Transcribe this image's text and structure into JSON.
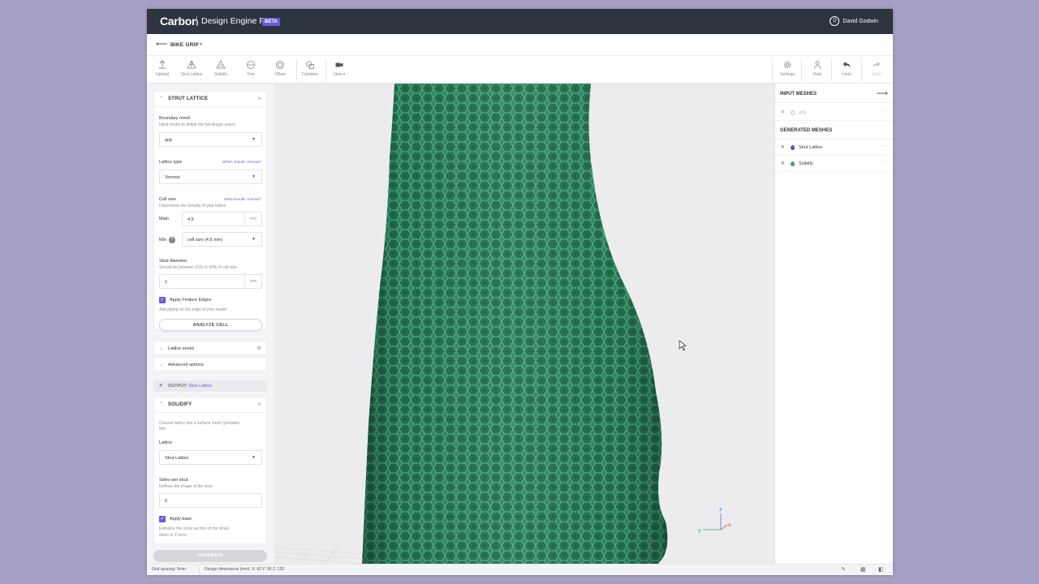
{
  "app": {
    "brand": "Carbon",
    "product": "Design Engine Pro",
    "beta_badge": "BETA",
    "user_initial": "D",
    "user_name": "David Godwin",
    "accent_color": "#6a5bd8"
  },
  "breadcrumb": {
    "back_icon": "arrow-left-icon",
    "project_name": "BIKE GRIP",
    "caret": "▾"
  },
  "toolbar": {
    "left_tools": [
      {
        "label": "Upload",
        "icon": "upload-icon"
      },
      {
        "label": "Strut Lattice",
        "icon": "lattice-icon"
      },
      {
        "label": "Solidify",
        "icon": "solidify-icon"
      },
      {
        "label": "Trim",
        "icon": "trim-icon"
      },
      {
        "label": "Offset",
        "icon": "offset-icon"
      },
      {
        "label": "Combine",
        "icon": "combine-icon"
      },
      {
        "label": "View ▾",
        "icon": "camera-icon"
      }
    ],
    "right_tools": [
      {
        "label": "Settings",
        "icon": "gear-icon"
      },
      {
        "label": "Help",
        "icon": "help-person-icon"
      },
      {
        "label": "Undo",
        "icon": "undo-icon"
      },
      {
        "label": "Redo",
        "icon": "redo-icon",
        "disabled": true
      }
    ]
  },
  "strut_lattice": {
    "title": "STRUT LATTICE",
    "boundary_label": "Boundary mesh",
    "boundary_desc": "Input model to define the full design space.",
    "boundary_value": "grip",
    "lattice_type_label": "Lattice type",
    "lattice_type_help": "Which should I choose?",
    "lattice_type_value": "Voronoi",
    "cell_size_label": "Cell size",
    "cell_size_help": "What should I choose?",
    "cell_size_desc": "Determines the density of your lattice",
    "main_label": "Main",
    "main_value": "4.5",
    "main_unit": "mm",
    "min_label": "Min",
    "min_help_glyph": "?",
    "min_value": "cell size (4.5 mm)",
    "strut_diameter_label": "Strut diameter",
    "strut_diameter_desc": "Should be between 10% to 30% of cell size",
    "strut_diameter_value": "1",
    "strut_diameter_unit": "mm",
    "feature_edges_label": "Apply Feature Edges",
    "feature_edges_checked": true,
    "feature_edges_desc": "Add piping on the edge of your model",
    "analyze_button": "ANALYZE CELL"
  },
  "lattice_zones": "Lattice zones",
  "advanced_options": "Advanced options",
  "output": {
    "prefix": "OUTPUT:",
    "name": "Strut Lattice"
  },
  "solidify": {
    "title": "SOLIDIFY",
    "desc_line1": "Convert lattice into a surface mesh (printable",
    "desc_line2": "file)",
    "lattice_label": "Lattice",
    "lattice_value": "Strut Lattice",
    "sides_label": "Sides per strut",
    "sides_desc": "Defines the shape of the strut",
    "sides_value": "6",
    "apply_base_label": "Apply base",
    "apply_base_checked": true,
    "apply_base_desc_line1": "Extrudes the cross section of the struts",
    "apply_base_desc_line2": "down to Z-zero."
  },
  "generate_button": "GENERATE",
  "right_panel": {
    "input_title": "INPUT MESHES",
    "input_items": [
      {
        "name": "grip",
        "dim": true,
        "color": "#ffffff"
      }
    ],
    "generated_title": "GENERATED MESHES",
    "generated_items": [
      {
        "name": "Strut Lattice",
        "dim": false,
        "color": "#5a4fcf"
      },
      {
        "name": "Solidify",
        "dim": false,
        "color": "#3aa37a"
      }
    ],
    "more_glyph": "···"
  },
  "axes": {
    "x": "x",
    "y": "y",
    "z": "z"
  },
  "status": {
    "grid_spacing": "Grid spacing: 5mm",
    "design_dims": "Design dimensions (mm): X: 42  Y: 59  Z: 125"
  },
  "colors": {
    "mesh_green": "#2e8a62",
    "titlebar": "#2c3440",
    "viewport_bg": "#ececee"
  }
}
